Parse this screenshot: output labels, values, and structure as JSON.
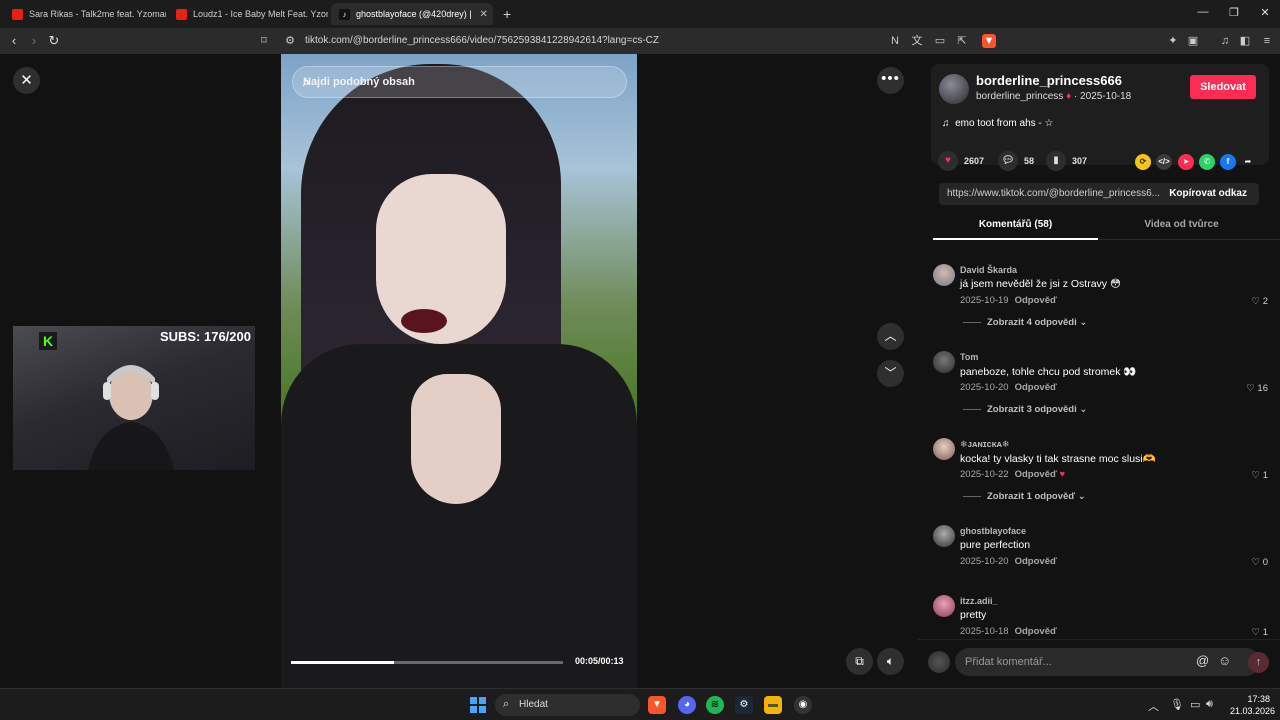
{
  "browser": {
    "tabs": [
      {
        "title": "Sara Rikas - Talk2me feat. Yzomandia",
        "favicon": "youtube-icon"
      },
      {
        "title": "Loudz1 - Ice Baby Melt Feat. Yzomandia",
        "favicon": "youtube-icon"
      },
      {
        "title": "ghostblayoface (@420drey) |",
        "favicon": "tiktok-icon",
        "active": true
      }
    ],
    "url": "tiktok.com/@borderline_princess666/video/7562593841228942614?lang=cs-CZ"
  },
  "video": {
    "search_placeholder": "Najdi podobný obsah",
    "time": "00:05/00:13",
    "progress": 0.38
  },
  "overlay": {
    "subs": "SUBS: 176/200"
  },
  "creator": {
    "name": "borderline_princess666",
    "handle": "borderline_princess",
    "date": "· 2025-10-18",
    "follow_label": "Sledovat",
    "music": "emo toot from ahs - ☆"
  },
  "stats": {
    "likes": "2607",
    "comments": "58",
    "saves": "307"
  },
  "share": {
    "link": "https://www.tiktok.com/@borderline_princess6...",
    "copy_label": "Kopírovat odkaz"
  },
  "panel_tabs": {
    "comments": "Komentářů (58)",
    "creator_videos": "Videa od tvůrce"
  },
  "comments": [
    {
      "user": "David Škarda",
      "text": "já jsem nevěděl že jsi z Ostravy 😳",
      "date": "2025-10-19",
      "reply": "Odpověď",
      "likes": "2",
      "more": "Zobrazit 4 odpovědi"
    },
    {
      "user": "Tom",
      "text": "paneboze, tohle chcu pod stromek 👀",
      "date": "2025-10-20",
      "reply": "Odpověď",
      "likes": "16",
      "more": "Zobrazit 3 odpovědi"
    },
    {
      "user": "❄︎ᴊᴀɴɪᴄᴋᴀ❄︎",
      "text": "kocka! ty vlasky ti tak strasne moc slusi🫶",
      "date": "2025-10-22",
      "reply": "Odpověď",
      "likes": "1",
      "more": "Zobrazit 1 odpověď"
    },
    {
      "user": "ghostblayoface",
      "text": "pure perfection",
      "date": "2025-10-20",
      "reply": "Odpověď",
      "likes": "0",
      "more": ""
    },
    {
      "user": "itzz.adii_",
      "text": "pretty",
      "date": "2025-10-18",
      "reply": "Odpověď",
      "likes": "1",
      "more": ""
    }
  ],
  "comment_input": {
    "placeholder": "Přidat komentář..."
  },
  "taskbar": {
    "search": "Hledat",
    "time": "17:38",
    "date": "21.03.2026"
  },
  "colors": {
    "accent": "#fe2c55",
    "background": "#121212",
    "panel": "#1e1e1e"
  }
}
